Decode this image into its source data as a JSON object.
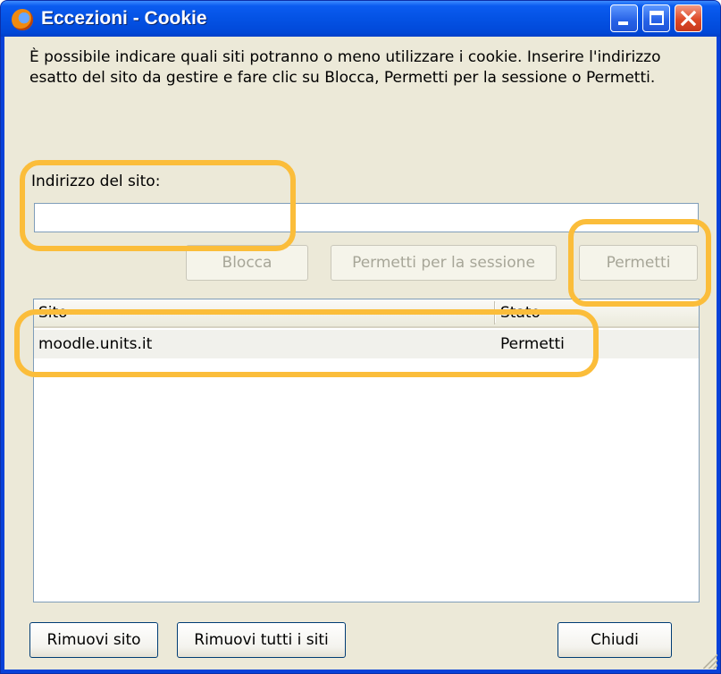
{
  "window": {
    "title": "Eccezioni - Cookie"
  },
  "description": "È possibile indicare quali siti potranno o meno utilizzare i cookie. Inserire l'indirizzo esatto del sito da gestire e fare clic su Blocca, Permetti per la sessione o Permetti.",
  "site_field": {
    "label": "Indirizzo del sito:",
    "value": "",
    "placeholder": ""
  },
  "actions": {
    "block_label": "Blocca",
    "session_label": "Permetti per la sessione",
    "allow_label": "Permetti"
  },
  "table": {
    "columns": [
      "Sito",
      "Stato"
    ],
    "rows": [
      {
        "site": "moodle.units.it",
        "status": "Permetti"
      }
    ]
  },
  "footer": {
    "remove_site_label": "Rimuovi sito",
    "remove_all_label": "Rimuovi tutti i siti",
    "close_label": "Chiudi"
  },
  "colors": {
    "titlebar": "#0452e4",
    "dialog_bg": "#ece9d8",
    "highlight": "#fbbd3a"
  }
}
